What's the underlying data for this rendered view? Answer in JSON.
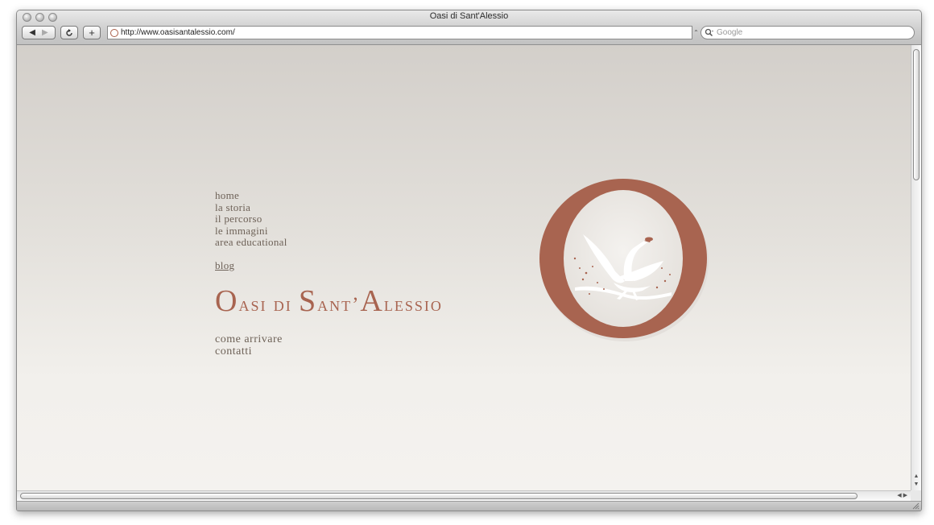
{
  "window": {
    "title": "Oasi di Sant'Alessio"
  },
  "toolbar": {
    "back_icon": "back-arrow-icon",
    "forward_icon": "forward-arrow-icon",
    "reload_icon": "reload-icon",
    "add_icon": "plus-icon",
    "url": "http://www.oasisantalessio.com/",
    "search_placeholder": "Google"
  },
  "nav": {
    "items": [
      {
        "label": "home"
      },
      {
        "label": "la storia"
      },
      {
        "label": "il percorso"
      },
      {
        "label": "le immagini"
      },
      {
        "label": "area educational"
      }
    ],
    "blog": "blog"
  },
  "site": {
    "title_initial_1": "O",
    "title_rest_1": "asi di ",
    "title_initial_2": "S",
    "title_rest_2": "ant’",
    "title_initial_3": "A",
    "title_rest_3": "lessio"
  },
  "bottom_nav": {
    "items": [
      {
        "label": "come arrivare"
      },
      {
        "label": "contatti"
      }
    ]
  },
  "colors": {
    "brand": "#a86450",
    "nav_text": "#6e6258"
  }
}
